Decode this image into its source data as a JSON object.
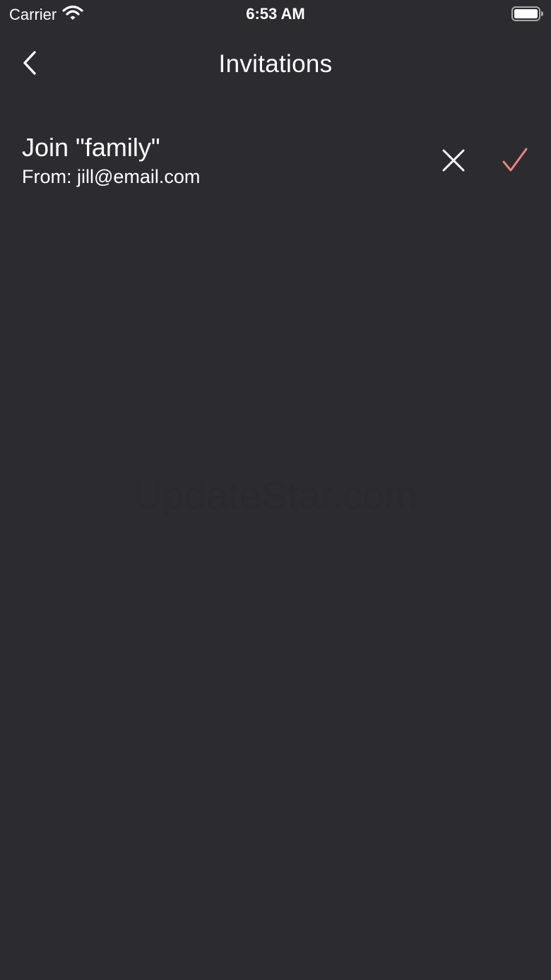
{
  "status_bar": {
    "carrier": "Carrier",
    "time": "6:53 AM"
  },
  "nav": {
    "title": "Invitations"
  },
  "invitations": [
    {
      "title": "Join \"family\"",
      "from": "From: jill@email.com"
    }
  ],
  "watermark": "UpdateStar.com",
  "colors": {
    "background": "#2c2b30",
    "text": "#ffffff",
    "accept_accent": "#e8847a"
  },
  "icons": {
    "back": "chevron-left-icon",
    "decline": "close-icon",
    "accept": "checkmark-icon",
    "wifi": "wifi-icon",
    "battery": "battery-icon"
  }
}
